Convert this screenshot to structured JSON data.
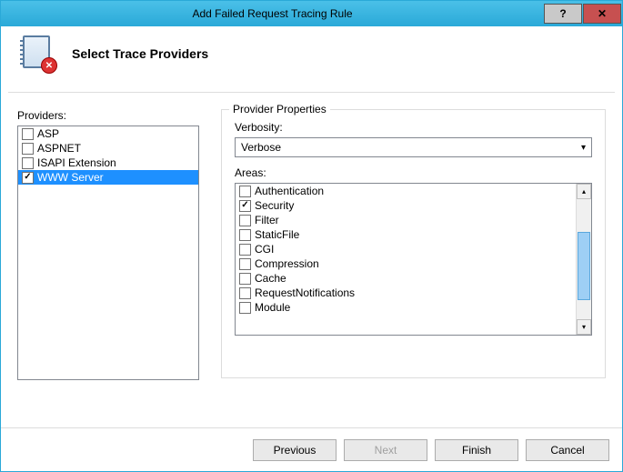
{
  "window": {
    "title": "Add Failed Request Tracing Rule"
  },
  "header": {
    "title": "Select Trace Providers"
  },
  "providers": {
    "label": "Providers:",
    "items": [
      {
        "label": "ASP",
        "checked": false,
        "selected": false
      },
      {
        "label": "ASPNET",
        "checked": false,
        "selected": false
      },
      {
        "label": "ISAPI Extension",
        "checked": false,
        "selected": false
      },
      {
        "label": "WWW Server",
        "checked": true,
        "selected": true
      }
    ]
  },
  "properties": {
    "legend": "Provider Properties",
    "verbosity_label": "Verbosity:",
    "verbosity_value": "Verbose",
    "areas_label": "Areas:",
    "areas": [
      {
        "label": "Authentication",
        "checked": false
      },
      {
        "label": "Security",
        "checked": true
      },
      {
        "label": "Filter",
        "checked": false
      },
      {
        "label": "StaticFile",
        "checked": false
      },
      {
        "label": "CGI",
        "checked": false
      },
      {
        "label": "Compression",
        "checked": false
      },
      {
        "label": "Cache",
        "checked": false
      },
      {
        "label": "RequestNotifications",
        "checked": false
      },
      {
        "label": "Module",
        "checked": false
      }
    ]
  },
  "buttons": {
    "previous": "Previous",
    "next": "Next",
    "finish": "Finish",
    "cancel": "Cancel"
  }
}
